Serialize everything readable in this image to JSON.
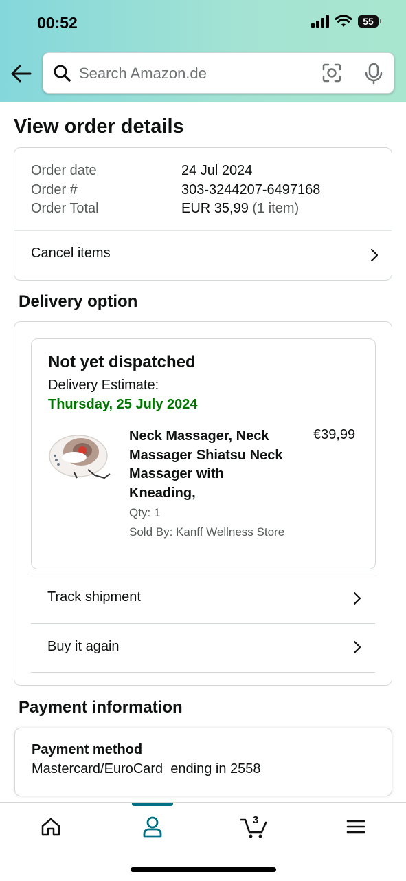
{
  "status_bar": {
    "time": "00:52",
    "battery": "55"
  },
  "search": {
    "placeholder": "Search Amazon.de"
  },
  "page_title": "View order details",
  "order_summary": {
    "rows": [
      {
        "label": "Order date",
        "value": "24 Jul 2024"
      },
      {
        "label": "Order #",
        "value": "303-3244207-6497168"
      },
      {
        "label": "Order Total",
        "value": "EUR 35,99",
        "note": "(1 item)"
      }
    ],
    "cancel_label": "Cancel items"
  },
  "delivery": {
    "section_title": "Delivery option",
    "status": "Not yet dispatched",
    "estimate_label": "Delivery Estimate:",
    "estimate_date": "Thursday, 25 July 2024",
    "item": {
      "title": "Neck Massager, Neck Massager Shiatsu Neck Massager with Kneading,",
      "price": "€39,99",
      "qty": "Qty: 1",
      "seller": "Sold By: Kanff Wellness Store"
    },
    "track_label": "Track shipment",
    "buy_again_label": "Buy it again"
  },
  "payment": {
    "section_title": "Payment information",
    "method_label": "Payment method",
    "method_value": "Mastercard/EuroCard  ending in 2558"
  },
  "bottom_nav": {
    "items": [
      "home-icon",
      "account-icon",
      "cart-icon",
      "menu-icon"
    ],
    "active": "account-icon",
    "cart_count": "3"
  },
  "colors": {
    "accent": "#007185",
    "delivery_green": "#007600",
    "header_start": "#84d7db",
    "header_end": "#a9e6cf"
  }
}
